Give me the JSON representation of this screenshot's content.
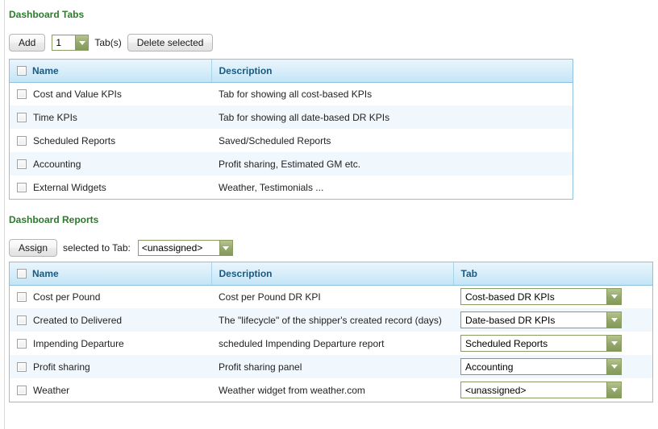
{
  "tabs_section": {
    "title": "Dashboard Tabs",
    "toolbar": {
      "add_label": "Add",
      "count_value": "1",
      "count_unit_label": "Tab(s)",
      "delete_label": "Delete selected",
      "spinner_arrow_icon": "chevron-down-icon"
    },
    "columns": [
      "Name",
      "Description"
    ],
    "rows": [
      {
        "name": "Cost and Value KPIs",
        "description": "Tab for showing all cost-based KPIs"
      },
      {
        "name": "Time KPIs",
        "description": "Tab for showing all date-based DR KPIs"
      },
      {
        "name": "Scheduled Reports",
        "description": "Saved/Scheduled Reports"
      },
      {
        "name": "Accounting",
        "description": "Profit sharing, Estimated GM etc."
      },
      {
        "name": "External Widgets",
        "description": "Weather, Testimonials ..."
      }
    ]
  },
  "reports_section": {
    "title": "Dashboard Reports",
    "toolbar": {
      "assign_label": "Assign",
      "assign_mid_label": "selected to Tab:",
      "assign_target_value": "<unassigned>",
      "select_arrow_icon": "chevron-down-icon"
    },
    "columns": [
      "Name",
      "Description",
      "Tab"
    ],
    "rows": [
      {
        "name": "Cost per Pound",
        "description": "Cost per Pound DR KPI",
        "tab": "Cost-based DR KPIs"
      },
      {
        "name": "Created to Delivered",
        "description": "The \"lifecycle\" of the shipper's created record (days)",
        "tab": "Date-based DR KPIs"
      },
      {
        "name": "Impending Departure",
        "description": "scheduled Impending Departure report",
        "tab": "Scheduled Reports"
      },
      {
        "name": "Profit sharing",
        "description": "Profit sharing panel",
        "tab": "Accounting"
      },
      {
        "name": "Weather",
        "description": "Weather widget from weather.com",
        "tab": "<unassigned>"
      }
    ]
  },
  "colors": {
    "section_title": "#2d7a2d",
    "grid_border": "#8fc0dd",
    "header_text": "#1a5a80",
    "select_border": "#8a9a63",
    "select_arrow_bg": "#93a76a",
    "row_alt_bg": "#f1f8fd"
  }
}
